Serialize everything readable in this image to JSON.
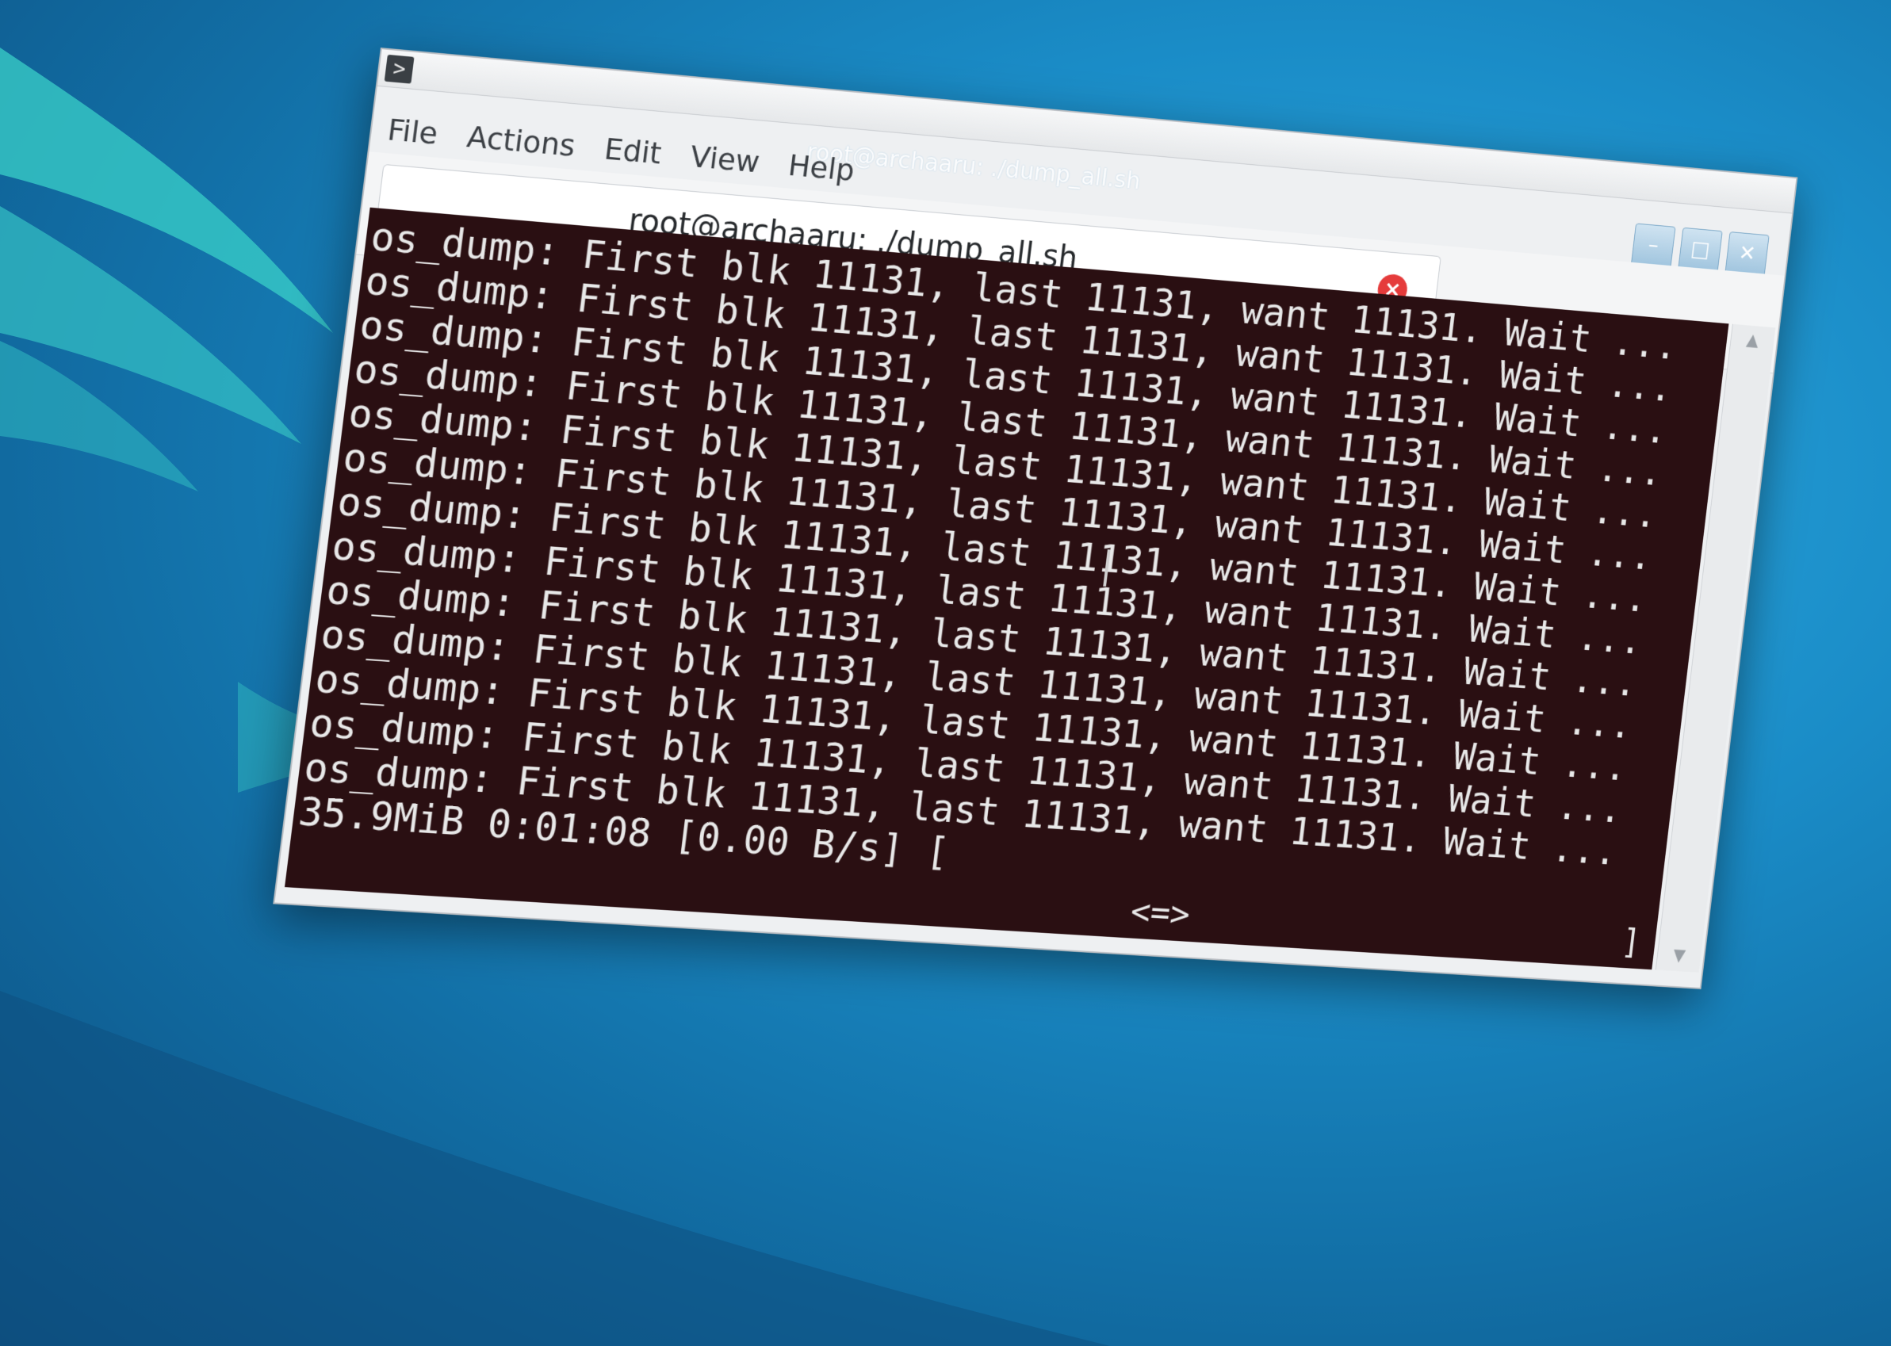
{
  "window": {
    "title": "root@archaaru: ./dump_all.sh",
    "app_icon": "terminal-icon"
  },
  "menubar": {
    "items": [
      "File",
      "Actions",
      "Edit",
      "View",
      "Help"
    ]
  },
  "window_controls": {
    "minimize": "minimize-icon",
    "maximize": "maximize-icon",
    "close": "close-icon"
  },
  "tab": {
    "label": "root@archaaru: ./dump_all.sh",
    "close_icon": "close-tab-icon"
  },
  "terminal": {
    "lines": [
      "os_dump: First blk 11131, last 11131, want 11131. Wait ...",
      "os_dump: First blk 11131, last 11131, want 11131. Wait ...",
      "os_dump: First blk 11131, last 11131, want 11131. Wait ...",
      "os_dump: First blk 11131, last 11131, want 11131. Wait ...",
      "os_dump: First blk 11131, last 11131, want 11131. Wait ...",
      "os_dump: First blk 11131, last 11131, want 11131. Wait ...",
      "os_dump: First blk 11131, last 11131, want 11131. Wait ...",
      "os_dump: First blk 11131, last 11131, want 11131. Wait ...",
      "os_dump: First blk 11131, last 11131, want 11131. Wait ...",
      "os_dump: First blk 11131, last 11131, want 11131. Wait ...",
      "os_dump: First blk 11131, last 11131, want 11131. Wait ...",
      "os_dump: First blk 11131, last 11131, want 11131. Wait ...",
      "os_dump: First blk 11131, last 11131, want 11131. Wait ...",
      "35.9MiB 0:01:08 [0.00 B/s] ["
    ],
    "progress_indicator": "<=>",
    "progress_end": "]"
  },
  "colors": {
    "terminal_bg": "#2a0f12",
    "terminal_fg": "#e8e8e8",
    "close_accent": "#e53b3b"
  }
}
